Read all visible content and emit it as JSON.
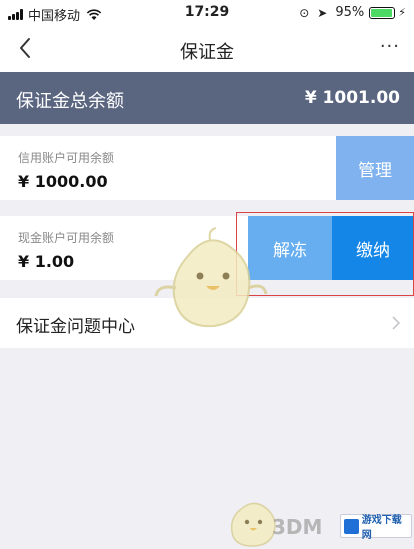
{
  "status_bar": {
    "carrier": "中国移动",
    "time": "17:29",
    "battery_percent": "95%",
    "battery_level": 0.95,
    "icons": [
      "signal-icon",
      "wifi-icon",
      "lock-rotation-icon",
      "location-icon",
      "battery-icon",
      "charging-icon"
    ]
  },
  "nav": {
    "title": "保证金",
    "more": "···"
  },
  "summary": {
    "label": "保证金总余额",
    "amount": "¥ 1001.00"
  },
  "credit_account": {
    "label": "信用账户可用余额",
    "value": "¥ 1000.00",
    "action": "管理"
  },
  "cash_account": {
    "label": "现金账户可用余额",
    "value": "¥ 1.00",
    "actions": {
      "unfreeze": "解冻",
      "pay": "缴纳"
    }
  },
  "faq": {
    "label": "保证金问题中心"
  },
  "watermark": {
    "text": "3DM",
    "badge": "游戏下载网"
  },
  "colors": {
    "summary_bg": "#5a6580",
    "manage_btn": "#7fb2ee",
    "unfreeze_btn": "#66aef0",
    "pay_btn": "#1386e8",
    "highlight_border": "#d94545"
  }
}
